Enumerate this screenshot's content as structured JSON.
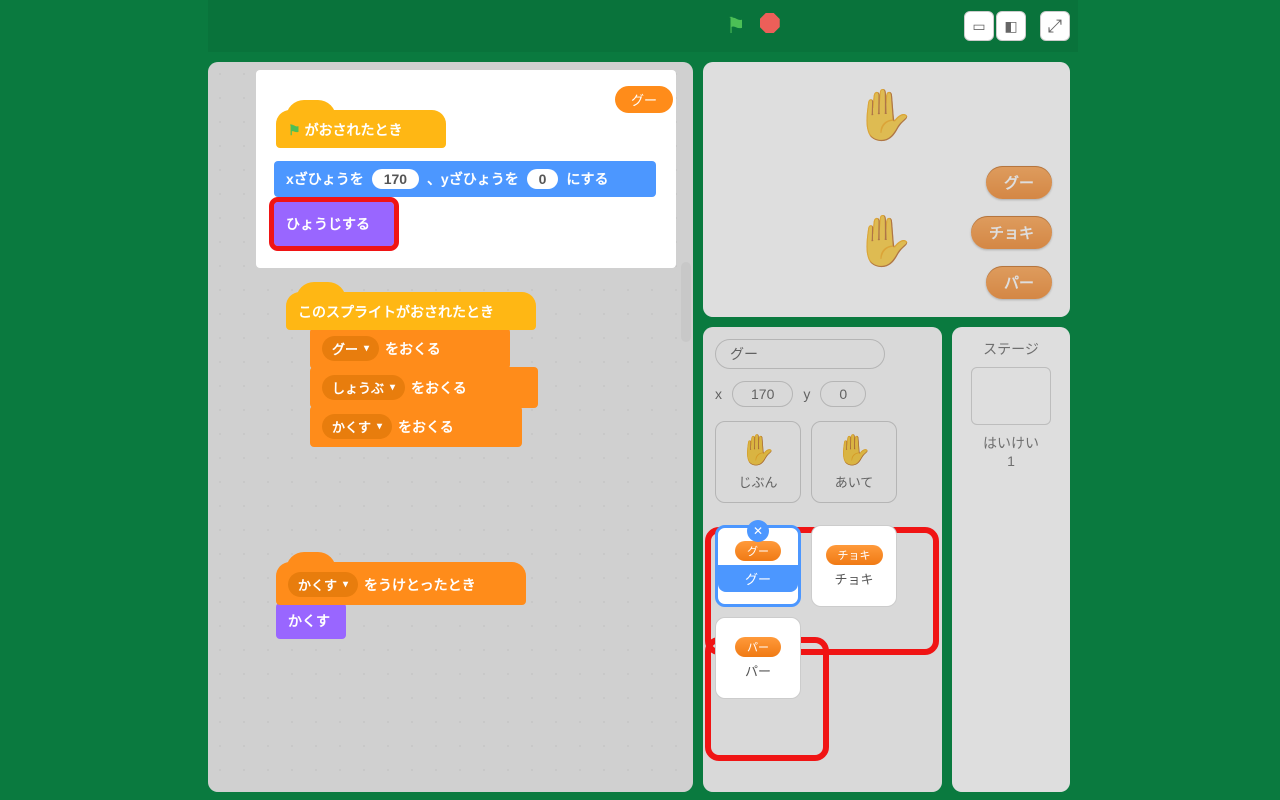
{
  "toolbar": {
    "flag_title": "go",
    "stop_title": "stop"
  },
  "highlight_pill": "グー",
  "blocks": {
    "when_flag": "がおされたとき",
    "goto": {
      "pre": "xざひょうを",
      "x": "170",
      "mid": "、yざひょうを",
      "y": "0",
      "post": "にする"
    },
    "show": "ひょうじする",
    "when_sprite_clicked": "このスプライトがおされたとき",
    "send": "をおくる",
    "opts": {
      "gu": "グー",
      "shoubu": "しょうぶ",
      "kakusu": "かくす"
    },
    "when_receive": {
      "dd": "かくす",
      "post": "をうけとったとき"
    },
    "hide": "かくす"
  },
  "stage_buttons": {
    "gu": "グー",
    "choki": "チョキ",
    "pa": "パー"
  },
  "sprite_info": {
    "name": "グー",
    "x_label": "x",
    "x": "170",
    "y_label": "y",
    "y": "0"
  },
  "stage_info": {
    "title": "ステージ",
    "back_label": "はいけい",
    "back_count": "1"
  },
  "sprites": {
    "jibun": "じぶん",
    "aite": "あいて",
    "gu": "グー",
    "choki": "チョキ",
    "pa": "パー"
  }
}
